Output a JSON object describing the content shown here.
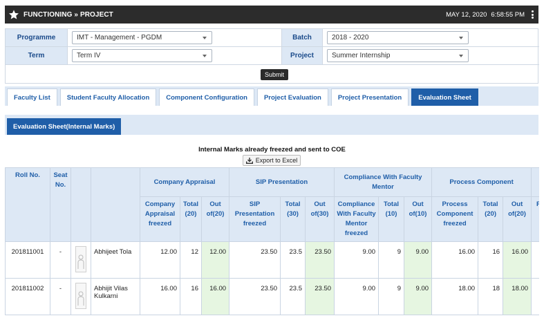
{
  "header": {
    "title": "FUNCTIONING » PROJECT",
    "date": "MAY 12, 2020",
    "time": "6:58:55 PM"
  },
  "filters": {
    "programme_label": "Programme",
    "programme_value": "IMT - Management - PGDM",
    "batch_label": "Batch",
    "batch_value": "2018 - 2020",
    "term_label": "Term",
    "term_value": "Term IV",
    "project_label": "Project",
    "project_value": "Summer Internship",
    "submit_label": "Submit"
  },
  "tabs": [
    {
      "label": "Faculty List",
      "active": false
    },
    {
      "label": "Student Faculty Allocation",
      "active": false
    },
    {
      "label": "Component Configuration",
      "active": false
    },
    {
      "label": "Project Evaluation",
      "active": false
    },
    {
      "label": "Project Presentation",
      "active": false
    },
    {
      "label": "Evaluation Sheet",
      "active": true
    }
  ],
  "subtab": {
    "label": "Evaluation Sheet(Internal Marks)"
  },
  "notice": "Internal Marks already freezed and sent to COE",
  "export_label": "Export to Excel",
  "table": {
    "fixed_headers": {
      "roll": "Roll No.",
      "seat": "Seat No."
    },
    "groups": [
      {
        "label": "Company Appraisal",
        "cols": [
          "Company Appraisal freezed",
          "Total (20)",
          "Out of(20)"
        ]
      },
      {
        "label": "SIP Presentation",
        "cols": [
          "SIP Presentation freezed",
          "Total (30)",
          "Out of(30)"
        ]
      },
      {
        "label": "Compliance With Faculty Mentor",
        "cols": [
          "Compliance With Faculty Mentor freezed",
          "Total (10)",
          "Out of(10)"
        ]
      },
      {
        "label": "Process Component",
        "cols": [
          "Process Component freezed",
          "Total (20)",
          "Out of(20)"
        ]
      },
      {
        "label": "",
        "cols": [
          "P R fr"
        ]
      }
    ],
    "rows": [
      {
        "roll": "201811001",
        "seat": "-",
        "name": "Abhijeet Tola",
        "values": [
          "12.00",
          "12",
          "12.00",
          "23.50",
          "23.5",
          "23.50",
          "9.00",
          "9",
          "9.00",
          "16.00",
          "16",
          "16.00"
        ]
      },
      {
        "roll": "201811002",
        "seat": "-",
        "name": "Abhijit Vilas Kulkarni",
        "values": [
          "16.00",
          "16",
          "16.00",
          "23.50",
          "23.5",
          "23.50",
          "9.00",
          "9",
          "9.00",
          "18.00",
          "18",
          "18.00"
        ]
      }
    ]
  },
  "colors": {
    "header_bg": "#2c2c2c",
    "accent": "#1f5ea8",
    "label_bg": "#dde8f5",
    "highlight": "#e6f6e1"
  }
}
